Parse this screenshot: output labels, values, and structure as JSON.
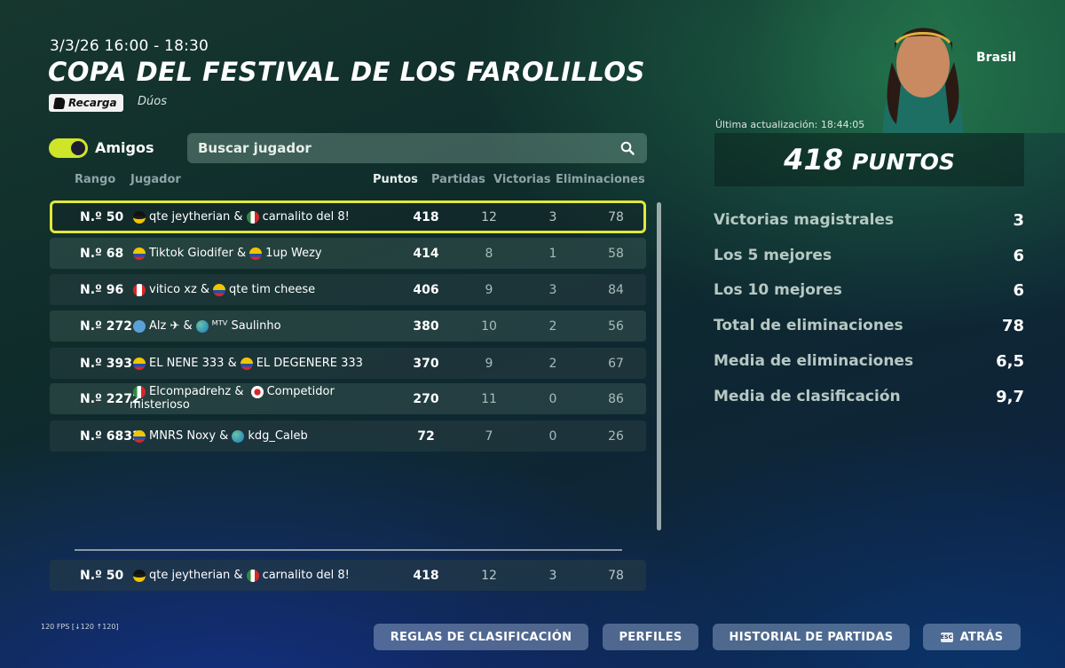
{
  "header": {
    "date_time": "3/3/26 16:00 - 18:30",
    "title": "COPA DEL FESTIVAL DE LOS FAROLILLOS",
    "mode_tag": "Recarga",
    "mode_sub": "Dúos"
  },
  "filters": {
    "friends_label": "Amigos",
    "friends_toggle_on": true,
    "search_placeholder": "Buscar jugador"
  },
  "table": {
    "columns": {
      "rank": "Rango",
      "player": "Jugador",
      "points": "Puntos",
      "matches": "Partidas",
      "wins": "Victorias",
      "eliminations": "Eliminaciones"
    },
    "rows": [
      {
        "rank": "N.º 50",
        "flag1": "#1a1a1a",
        "p1": "qte jeytherian",
        "sep": "&",
        "flag2": "#2e8b3e",
        "p2": "carnalito del 8!",
        "points": "418",
        "matches": "12",
        "wins": "3",
        "eliminations": "78"
      },
      {
        "rank": "N.º 68",
        "flag1": "#f2c500",
        "p1": "Tiktok Giodifer",
        "sep": "&",
        "flag2": "#f2c500",
        "p2": "1up Wezy",
        "points": "414",
        "matches": "8",
        "wins": "1",
        "eliminations": "58"
      },
      {
        "rank": "N.º 96",
        "flag1": "#d8262b",
        "p1": "vitico xz",
        "sep": "&",
        "flag2": "#f2c500",
        "p2": "qte tim cheese",
        "points": "406",
        "matches": "9",
        "wins": "3",
        "eliminations": "84"
      },
      {
        "rank": "N.º 272",
        "flag1": "#5aa0d8",
        "p1": "Alz ✈",
        "sep": "&",
        "flag2": "#2f8fbd",
        "p2": "ᴹᵀⱽ Saulinho",
        "points": "380",
        "matches": "10",
        "wins": "2",
        "eliminations": "56"
      },
      {
        "rank": "N.º 393",
        "flag1": "#f2c500",
        "p1": "EL NENE 333",
        "sep": "&",
        "flag2": "#f2c500",
        "p2": "EL DEGENERE 333",
        "points": "370",
        "matches": "9",
        "wins": "2",
        "eliminations": "67"
      },
      {
        "rank": "N.º 2272",
        "flag1": "#2e8b3e",
        "p1": "Elcompadrehz",
        "sep": "&",
        "flag2": "#ffffff",
        "p2": "Competidor misterioso",
        "points": "270",
        "matches": "11",
        "wins": "0",
        "eliminations": "86"
      },
      {
        "rank": "N.º 6833",
        "flag1": "#f2c500",
        "p1": "MNRS Noxy",
        "sep": "&",
        "flag2": "#2f8fbd",
        "p2": "kdg_Caleb",
        "points": "72",
        "matches": "7",
        "wins": "0",
        "eliminations": "26"
      }
    ],
    "footer_row": {
      "rank": "N.º 50",
      "flag1": "#1a1a1a",
      "p1": "qte jeytherian",
      "sep": "&",
      "flag2": "#2e8b3e",
      "p2": "carnalito del 8!",
      "points": "418",
      "matches": "12",
      "wins": "3",
      "eliminations": "78"
    }
  },
  "panel": {
    "region": "Brasil",
    "last_update": "Última actualización: 18:44:05",
    "points_value": "418",
    "points_word": "PUNTOS",
    "stats": [
      {
        "label": "Victorias magistrales",
        "value": "3"
      },
      {
        "label": "Los 5 mejores",
        "value": "6"
      },
      {
        "label": "Los 10 mejores",
        "value": "6"
      },
      {
        "label": "Total de eliminaciones",
        "value": "78"
      },
      {
        "label": "Media de eliminaciones",
        "value": "6,5"
      },
      {
        "label": "Media de clasificación",
        "value": "9,7"
      }
    ]
  },
  "footer": {
    "fps": "120 FPS [↓120 ↑120]",
    "buttons": {
      "rules": "REGLAS DE CLASIFICACIÓN",
      "profiles": "PERFILES",
      "history": "HISTORIAL DE PARTIDAS",
      "back": "ATRÁS",
      "esc": "ESC"
    }
  },
  "colors": {
    "accent": "#cfe52a",
    "selection_border": "#e1e83a"
  }
}
